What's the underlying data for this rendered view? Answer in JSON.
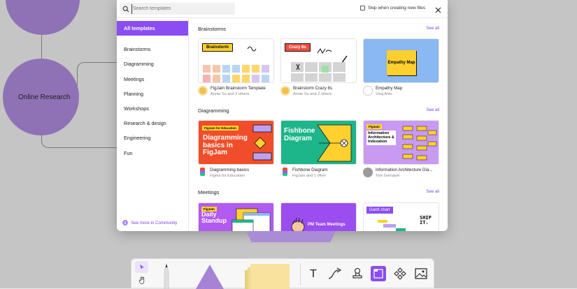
{
  "canvas": {
    "node_label": "Online Research"
  },
  "dialog": {
    "search_placeholder": "Search templates",
    "skip_label": "Skip when creating new files"
  },
  "sidebar": {
    "items": [
      {
        "label": "All templates",
        "active": true
      },
      {
        "label": "Brainstorms"
      },
      {
        "label": "Diagramming"
      },
      {
        "label": "Meetings"
      },
      {
        "label": "Planning"
      },
      {
        "label": "Workshops"
      },
      {
        "label": "Research & design"
      },
      {
        "label": "Engineering"
      },
      {
        "label": "Fun"
      }
    ],
    "community_link": "See more in Community"
  },
  "sections": [
    {
      "title": "Brainstorms",
      "see_all": "See all",
      "cards": [
        {
          "name": "FigJam Brainstorm Template",
          "author": "Annie Su and 3 others",
          "thumb_label": "Brainstorm"
        },
        {
          "name": "Brainstorm Crazy 8s",
          "author": "Annie Su and 2 others",
          "thumb_label": "Crazy 8s"
        },
        {
          "name": "Empathy Map",
          "author": "Viraj Aher",
          "thumb_label": "Empathy Map"
        }
      ]
    },
    {
      "title": "Diagramming",
      "see_all": "See all",
      "cards": [
        {
          "name": "Diagramming basics",
          "author": "Figma for Education",
          "thumb_tag": "FigJam for Education",
          "thumb_label": "Diagramming basics in FigJam"
        },
        {
          "name": "Fishbone Diagram",
          "author": "FigJam and 1 other",
          "thumb_label": "Fishbone Diagram"
        },
        {
          "name": "Information Architecture Dia...",
          "author": "Toni Gemayel",
          "thumb_tag": "FigJam",
          "thumb_label": "Information Architecture & Indexation"
        }
      ]
    },
    {
      "title": "Meetings",
      "see_all": "See all",
      "cards": [
        {
          "thumb_tag": "FigJam",
          "thumb_label": "Daily Standup"
        },
        {
          "thumb_label": "PM Team Meetings"
        },
        {
          "thumb_label": "Gantt chart",
          "thumb_doodle": "SHIP IT."
        }
      ]
    }
  ],
  "toolbar": {
    "tools": [
      "cursor",
      "hand",
      "marker",
      "shape",
      "sticky",
      "text",
      "connector",
      "stamp",
      "section",
      "components",
      "image"
    ],
    "text_tool_label": "T"
  },
  "colors": {
    "accent": "#8a4df2",
    "node_purple": "#a783d6",
    "canvas": "#e8e8e8"
  }
}
